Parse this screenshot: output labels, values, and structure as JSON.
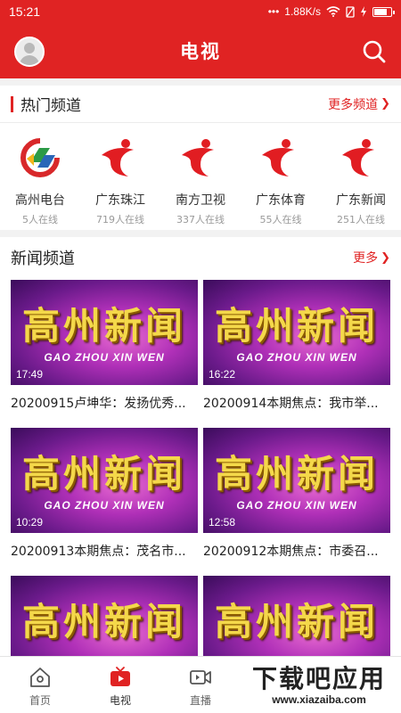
{
  "status_bar": {
    "time": "15:21",
    "net_speed": "1.88K/s",
    "icons": [
      "dots-icon",
      "wifi-icon",
      "no-sim-icon",
      "charging-icon",
      "battery-icon"
    ]
  },
  "header": {
    "title": "电视",
    "avatar_icon": "user-avatar-icon",
    "search_icon": "search-icon",
    "background": "#e02323"
  },
  "hot_channels": {
    "title": "热门频道",
    "more_label": "更多频道",
    "items": [
      {
        "name": "高州电台",
        "online": "5人在线",
        "logo": "gaozhou-logo"
      },
      {
        "name": "广东珠江",
        "online": "719人在线",
        "logo": "gdtv-logo"
      },
      {
        "name": "南方卫视",
        "online": "337人在线",
        "logo": "gdtv-logo"
      },
      {
        "name": "广东体育",
        "online": "55人在线",
        "logo": "gdtv-logo"
      },
      {
        "name": "广东新闻",
        "online": "251人在线",
        "logo": "gdtv-logo"
      }
    ]
  },
  "news_channel": {
    "title": "新闻频道",
    "more_label": "更多",
    "thumb_title": "高州新闻",
    "thumb_subtitle": "GAO ZHOU XIN WEN",
    "videos": [
      {
        "duration": "17:49",
        "title": "20200915卢坤华：发扬优秀..."
      },
      {
        "duration": "16:22",
        "title": "20200914本期焦点：我市举..."
      },
      {
        "duration": "10:29",
        "title": "20200913本期焦点：茂名市..."
      },
      {
        "duration": "12:58",
        "title": "20200912本期焦点：市委召..."
      },
      {
        "duration": "",
        "title": ""
      },
      {
        "duration": "",
        "title": ""
      }
    ]
  },
  "tab_bar": {
    "tabs": [
      {
        "label": "首页",
        "icon": "home-icon",
        "active": false
      },
      {
        "label": "电视",
        "icon": "tv-icon",
        "active": true
      },
      {
        "label": "直播",
        "icon": "video-camera-icon",
        "active": false
      }
    ]
  },
  "watermark": {
    "line1": "下载吧应用",
    "line2": "www.xiazaiba.com"
  }
}
